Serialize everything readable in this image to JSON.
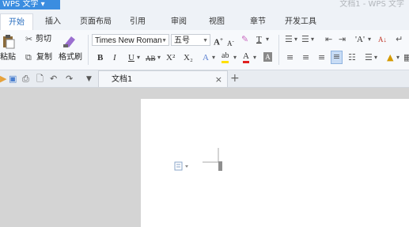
{
  "window": {
    "app_button": "WPS 文字",
    "title": "文档1 - WPS 文字"
  },
  "tabs": [
    {
      "label": "开始",
      "active": true
    },
    {
      "label": "插入"
    },
    {
      "label": "页面布局"
    },
    {
      "label": "引用"
    },
    {
      "label": "审阅"
    },
    {
      "label": "视图"
    },
    {
      "label": "章节"
    },
    {
      "label": "开发工具"
    }
  ],
  "ribbon": {
    "cut": "剪切",
    "paste": "粘贴",
    "copy": "复制",
    "format_painter": "格式刷",
    "font_name": "Times New Roman",
    "font_size": "五号",
    "bold": "B",
    "italic": "I",
    "underline": "U",
    "strike": "AB",
    "superscript": "X²",
    "subscript": "X₂",
    "font_color": "A",
    "char_shading": "A",
    "grow_font": "A",
    "shrink_font": "A",
    "text_effect": "A",
    "highlight": "ab",
    "sort": "A↓",
    "case": "A"
  },
  "doc_tab": {
    "label": "文档1",
    "close": "×"
  },
  "add_tab": "+",
  "colors": {
    "accent": "#3b8de0",
    "tab_active_text": "#2b6fbf",
    "font_color_bar": "#e02020",
    "highlight_bar": "#ffe000"
  }
}
